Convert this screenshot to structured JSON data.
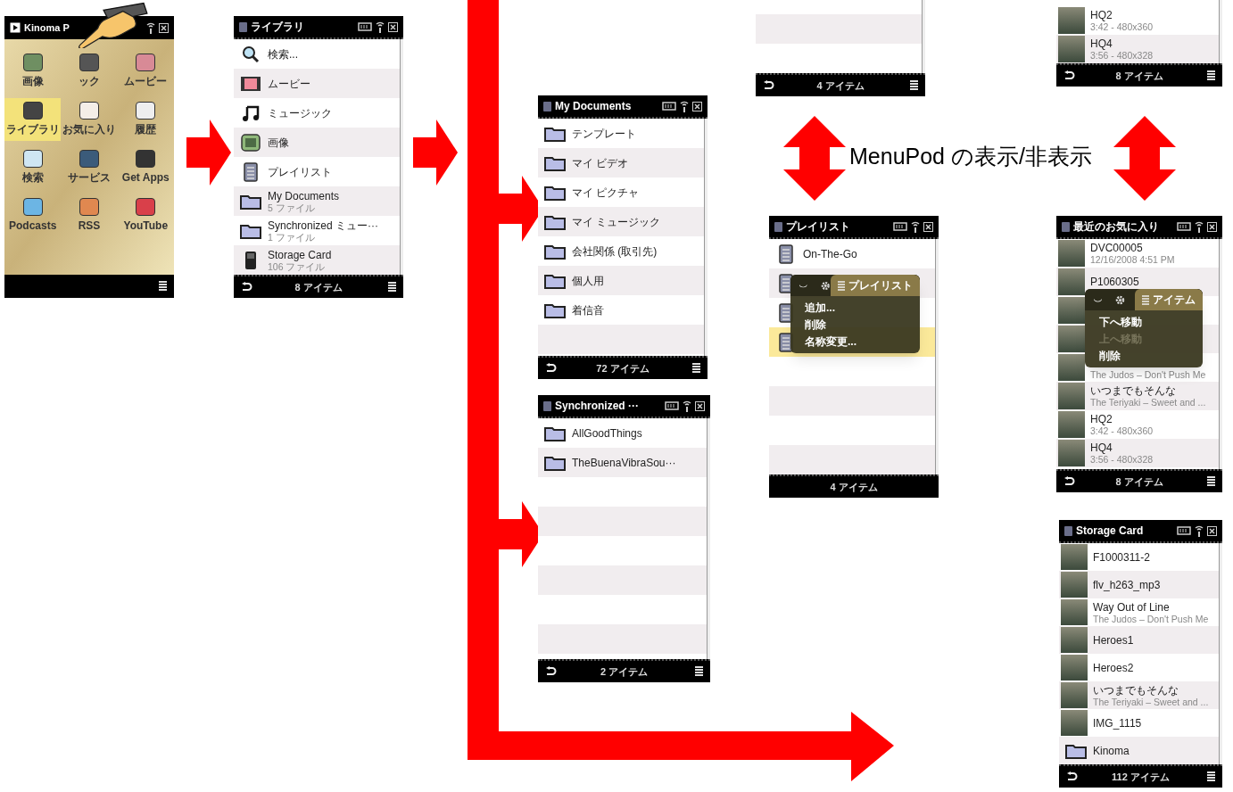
{
  "caption": "MenuPod の表示/非表示",
  "screens": [
    {
      "kind": "home",
      "title": "Kinoma P",
      "tiles": [
        {
          "label": "画像",
          "selected": false
        },
        {
          "label": "ック",
          "selected": false
        },
        {
          "label": "ムービー",
          "selected": false
        },
        {
          "label": "ライブラリ",
          "selected": true
        },
        {
          "label": "お気に入り",
          "selected": false
        },
        {
          "label": "履歴",
          "selected": false
        },
        {
          "label": "検索",
          "selected": false
        },
        {
          "label": "サービス",
          "selected": false
        },
        {
          "label": "Get Apps",
          "selected": false
        },
        {
          "label": "Podcasts",
          "selected": false
        },
        {
          "label": "RSS",
          "selected": false
        },
        {
          "label": "YouTube",
          "selected": false
        }
      ]
    },
    {
      "kind": "list",
      "title": "ライブラリ",
      "footer": "8 アイテム",
      "back": true,
      "items": [
        {
          "kind": "search",
          "label": "検索..."
        },
        {
          "kind": "movie",
          "label": "ムービー"
        },
        {
          "kind": "music",
          "label": "ミュージック"
        },
        {
          "kind": "image",
          "label": "画像"
        },
        {
          "kind": "playlist",
          "label": "プレイリスト"
        },
        {
          "kind": "folder",
          "label": "My Documents",
          "sub": "5 ファイル"
        },
        {
          "kind": "folder",
          "label": "Synchronized ミュー···",
          "sub": "1 ファイル"
        },
        {
          "kind": "card",
          "label": "Storage Card",
          "sub": "106 ファイル"
        }
      ]
    },
    {
      "kind": "list",
      "title": "My Documents",
      "footer": "72 アイテム",
      "back": true,
      "items": [
        {
          "kind": "folder",
          "label": "テンプレート"
        },
        {
          "kind": "folder",
          "label": "マイ ビデオ"
        },
        {
          "kind": "folder",
          "label": "マイ ピクチャ"
        },
        {
          "kind": "folder",
          "label": "マイ ミュージック"
        },
        {
          "kind": "folder",
          "label": "会社関係 (取引先)"
        },
        {
          "kind": "folder",
          "label": "個人用"
        },
        {
          "kind": "folder",
          "label": "着信音"
        }
      ]
    },
    {
      "kind": "list",
      "title": "Synchronized ···",
      "footer": "2 アイテム",
      "back": true,
      "items": [
        {
          "kind": "folder",
          "label": "AllGoodThings"
        },
        {
          "kind": "folder",
          "label": "TheBuenaVibraSou···"
        }
      ]
    },
    {
      "kind": "partial",
      "footer": "4 アイテム",
      "back": true
    },
    {
      "kind": "partial",
      "footer": "8 アイテム",
      "back": true,
      "items": [
        {
          "kind": "photo",
          "label": "HQ2",
          "sub": "3:42 - 480x360"
        },
        {
          "kind": "photo",
          "label": "HQ4",
          "sub": "3:56 - 480x328"
        }
      ]
    },
    {
      "kind": "list",
      "title": "プレイリスト",
      "footer": "4 アイテム",
      "back": false,
      "items": [
        {
          "kind": "playlist",
          "label": "On-The-Go",
          "selected": false
        },
        {
          "kind": "playlist",
          "selected": false
        },
        {
          "kind": "playlist",
          "selected": false
        },
        {
          "kind": "playlist",
          "selected": true
        }
      ],
      "menu": {
        "tab": "プレイリスト",
        "items": [
          {
            "label": "追加...",
            "disabled": false
          },
          {
            "label": "削除",
            "disabled": false
          },
          {
            "label": "名称変更...",
            "disabled": false
          }
        ]
      }
    },
    {
      "kind": "list",
      "title": "最近のお気に入り",
      "footer": "8 アイテム",
      "back": true,
      "items": [
        {
          "kind": "photo",
          "label": "DVC00005",
          "sub": "12/16/2008 4:51 PM"
        },
        {
          "kind": "photo",
          "label": "P1060305"
        },
        {
          "kind": "photo"
        },
        {
          "kind": "photo"
        },
        {
          "kind": "photo",
          "sub": "The Judos – Don't Push Me"
        },
        {
          "kind": "photo",
          "label": "いつまでもそんな",
          "sub": "The Teriyaki – Sweet and ..."
        },
        {
          "kind": "photo",
          "label": "HQ2",
          "sub": "3:42 - 480x360"
        },
        {
          "kind": "photo",
          "label": "HQ4",
          "sub": "3:56 - 480x328"
        }
      ],
      "menu": {
        "tab": "アイテム",
        "items": [
          {
            "label": "下へ移動",
            "disabled": false
          },
          {
            "label": "上へ移動",
            "disabled": true
          },
          {
            "label": "削除",
            "disabled": false
          }
        ]
      }
    },
    {
      "kind": "list",
      "title": "Storage Card",
      "footer": "112 アイテム",
      "back": true,
      "items": [
        {
          "kind": "photo",
          "label": "F1000311-2"
        },
        {
          "kind": "photo",
          "label": "flv_h263_mp3"
        },
        {
          "kind": "photo",
          "label": "Way Out of Line",
          "sub": "The Judos – Don't Push Me"
        },
        {
          "kind": "photo",
          "label": "Heroes1"
        },
        {
          "kind": "photo",
          "label": "Heroes2"
        },
        {
          "kind": "photo",
          "label": "いつまでもそんな",
          "sub": "The Teriyaki – Sweet and ..."
        },
        {
          "kind": "photo",
          "label": "IMG_1115"
        },
        {
          "kind": "folder",
          "label": "Kinoma"
        }
      ]
    }
  ]
}
